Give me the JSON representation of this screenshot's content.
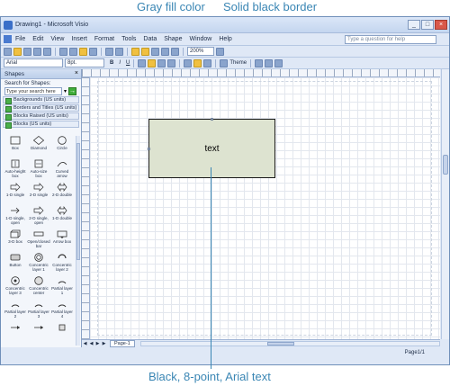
{
  "callouts": {
    "fill": "Gray fill color",
    "border": "Solid black border",
    "text": "Black, 8-point, Arial text"
  },
  "window": {
    "title": "Drawing1 - Microsoft Visio",
    "buttons": [
      "_",
      "□",
      "×"
    ]
  },
  "menu": {
    "items": [
      "File",
      "Edit",
      "View",
      "Insert",
      "Format",
      "Tools",
      "Data",
      "Shape",
      "Window",
      "Help"
    ],
    "help_placeholder": "Type a question for help"
  },
  "toolbar": {
    "zoom": "200%",
    "font": "Arial",
    "font_size": "8pt.",
    "bold": "B",
    "italic": "I",
    "underline": "U",
    "theme": "Theme"
  },
  "shapes_pane": {
    "title": "Shapes",
    "search_label": "Search for Shapes:",
    "search_placeholder": "Type your search here",
    "stencils": [
      "Backgrounds (US units)",
      "Borders and Titles (US units)",
      "Blocks Raised (US units)",
      "Blocks (US units)"
    ],
    "shapes": [
      "Box",
      "Diamond",
      "Circle",
      "Auto-height box",
      "Auto-size box",
      "Curved arrow",
      "1-D single",
      "2-D single",
      "2-D double",
      "1-D single, open",
      "2-D single, open",
      "1-D double",
      "3-D box",
      "Open/closed bar",
      "Arrow box",
      "Button",
      "Concentric layer 1",
      "Concentric layer 2",
      "Concentric layer 3",
      "Concentric center",
      "Partial layer 1",
      "Partial layer 2",
      "Partial layer 3",
      "Partial layer 4",
      "",
      "",
      ""
    ]
  },
  "canvas": {
    "shape_text": "text",
    "fill_color": "#dde3d0",
    "border_color": "#1a1a1a"
  },
  "status": {
    "page_tab": "Page-1",
    "page_indicator": "Page1/1",
    "nav": [
      "◀",
      "◀",
      "▶",
      "▶"
    ]
  }
}
